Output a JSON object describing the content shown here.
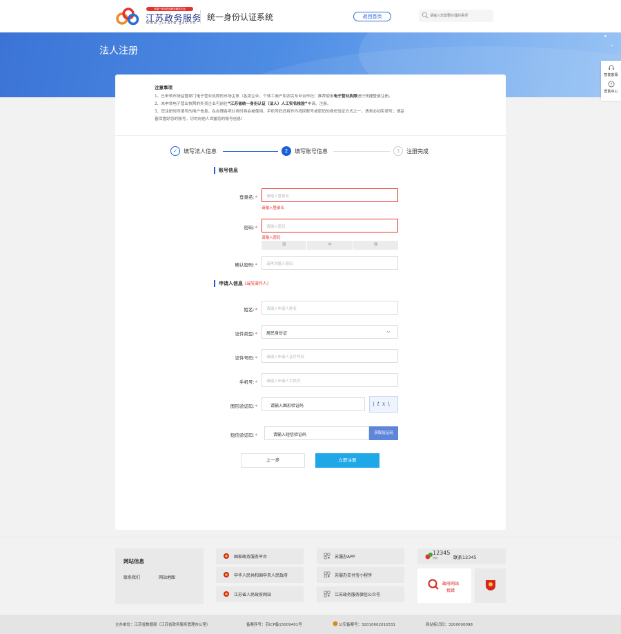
{
  "header": {
    "logo_badge": "全国一体化在线政务服务平台",
    "logo_name": "江苏政务服务",
    "logo_url": "www.jszwfw.gov.cn",
    "system_title": "统一身份认证系统",
    "home_button": "返回首页",
    "search_placeholder": "请输入您需要办理的事项"
  },
  "page_title": "法人注册",
  "side_float": {
    "items": [
      {
        "label": "智能客服",
        "icon": "headset-icon"
      },
      {
        "label": "帮助中心",
        "icon": "help-circle-icon"
      }
    ]
  },
  "notice": {
    "title": "注意事项",
    "line1_prefix": "1、已申领市场监管部门电子营业执照的市场主体（各类企业、个体工商户和农民专业合作社）推荐使用",
    "line1_bold": "电子营业执照",
    "line1_suffix": "进行快捷登录注册。",
    "line2_prefix": "2、未申领电子营业执照的外资企业可前往",
    "line2_bold": "“江苏省统一身份认证（法人）人工实名核验”",
    "line2_suffix": "申请。注册。",
    "line3": "3、您注册时所填写的用户信息，在办理各项业务时将会被使用，手机号码还将作为找回账号或密码的身份验证方式之一，请务必如实填写；请妥",
    "line4": "善保管好您的账号，切勿向他人泄露您的账号信息!"
  },
  "steps": [
    {
      "num": "✓",
      "label": "填写法人信息",
      "state": "done"
    },
    {
      "num": "2",
      "label": "填写账号信息",
      "state": "active"
    },
    {
      "num": "3",
      "label": "注册完成",
      "state": "pending"
    }
  ],
  "account_section": {
    "title": "账号信息",
    "login_label": "登录名:",
    "login_placeholder": "请输入登录名",
    "login_error": "请输入登录名",
    "password_label": "密码:",
    "password_placeholder": "请输入密码",
    "password_error": "请输入密码",
    "strength": [
      "弱",
      "中",
      "强"
    ],
    "confirm_label": "确认密码:",
    "confirm_placeholder": "请再次输入密码"
  },
  "applicant_section": {
    "title": "申请人信息",
    "note": "(当前操作人)",
    "name_label": "姓名:",
    "name_placeholder": "请输入申请人姓名",
    "id_type_label": "证件类型:",
    "id_type_value": "居民身份证",
    "id_no_label": "证件号码:",
    "id_no_placeholder": "请输入申请人证件号码",
    "phone_label": "手机号:",
    "phone_placeholder": "请输入申请人手机号",
    "captcha_label": "图形验证码:",
    "captcha_placeholder": "请输入图形验证码",
    "captcha_text": "\\tx\\",
    "sms_label": "短信验证码:",
    "sms_placeholder": "请输入短信验证码",
    "sms_button": "获取验证码"
  },
  "buttons": {
    "prev": "上一步",
    "submit": "立即注册"
  },
  "footer": {
    "site_info_title": "网站信息",
    "contact": "联系我们",
    "sitemap": "网站地图",
    "links_col1": [
      "国家政务服务平台",
      "中华人民共和国中央人民政府",
      "江苏省人民政府网站"
    ],
    "links_col2": [
      "苏服办APP",
      "苏服办支付宝小程序",
      "江苏政务服务微信公众号"
    ],
    "hotline_logo": "12345",
    "hotline_sub": "热线",
    "hotline": "联系12345",
    "gov_badge_title": "政府网站",
    "gov_badge_sub": "找错"
  },
  "bottom": {
    "host": "主办单位：江苏省数据局（江苏省政务服务管理办公室）",
    "icp": "备案序号：苏ICP备15009401号",
    "police": "公安备案号：32010602010331",
    "site_code": "网站标识码：3200000098"
  },
  "colors": {
    "primary": "#1a5fd6",
    "error": "#e5322d",
    "submit": "#1fa7e8",
    "sms": "#5d85d9"
  }
}
